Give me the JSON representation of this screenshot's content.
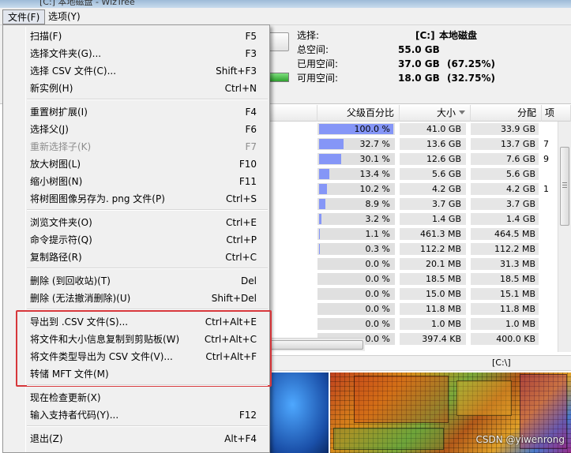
{
  "window": {
    "title": "[C:] 本地磁盘 - WizTree"
  },
  "menubar": {
    "file_label": "文件(F)",
    "options_label": "选项(Y)"
  },
  "drive_info": {
    "select_label": "选择:",
    "drive": "[C:]",
    "drive_name": "本地磁盘",
    "total_label": "总空间:",
    "total_value": "55.0 GB",
    "used_label": "已用空间:",
    "used_value": "37.0 GB",
    "used_pct": "(67.25%)",
    "free_label": "可用空间:",
    "free_value": "18.0 GB",
    "free_pct": "(32.75%)"
  },
  "columns": {
    "parent_pct": "父级百分比",
    "size": "大小",
    "allocated": "分配",
    "items_short": "项"
  },
  "rows": [
    {
      "pct": "100.0 %",
      "fill": 100.0,
      "size": "41.0 GB",
      "alloc": "33.9 GB",
      "x": ""
    },
    {
      "pct": "32.7 %",
      "fill": 32.7,
      "size": "13.6 GB",
      "alloc": "13.7 GB",
      "x": "7"
    },
    {
      "pct": "30.1 %",
      "fill": 30.1,
      "size": "12.6 GB",
      "alloc": "7.6 GB",
      "x": "9"
    },
    {
      "pct": "13.4 %",
      "fill": 13.4,
      "size": "5.6 GB",
      "alloc": "5.6 GB",
      "x": ""
    },
    {
      "pct": "10.2 %",
      "fill": 10.2,
      "size": "4.2 GB",
      "alloc": "4.2 GB",
      "x": "1"
    },
    {
      "pct": "8.9 %",
      "fill": 8.9,
      "size": "3.7 GB",
      "alloc": "3.7 GB",
      "x": ""
    },
    {
      "pct": "3.2 %",
      "fill": 3.2,
      "size": "1.4 GB",
      "alloc": "1.4 GB",
      "x": ""
    },
    {
      "pct": "1.1 %",
      "fill": 1.1,
      "size": "461.3 MB",
      "alloc": "464.5 MB",
      "x": ""
    },
    {
      "pct": "0.3 %",
      "fill": 0.3,
      "size": "112.2 MB",
      "alloc": "112.2 MB",
      "x": ""
    },
    {
      "pct": "0.0 %",
      "fill": 0.0,
      "size": "20.1 MB",
      "alloc": "31.3 MB",
      "x": ""
    },
    {
      "pct": "0.0 %",
      "fill": 0.0,
      "size": "18.5 MB",
      "alloc": "18.5 MB",
      "x": ""
    },
    {
      "pct": "0.0 %",
      "fill": 0.0,
      "size": "15.0 MB",
      "alloc": "15.1 MB",
      "x": ""
    },
    {
      "pct": "0.0 %",
      "fill": 0.0,
      "size": "11.8 MB",
      "alloc": "11.8 MB",
      "x": ""
    },
    {
      "pct": "0.0 %",
      "fill": 0.0,
      "size": "1.0 MB",
      "alloc": "1.0 MB",
      "x": ""
    },
    {
      "pct": "0.0 %",
      "fill": 0.0,
      "size": "397.4 KB",
      "alloc": "400.0 KB",
      "x": ""
    }
  ],
  "statusbar": {
    "path": "[C:\\]"
  },
  "watermark": "CSDN @yiwenrong",
  "file_menu": [
    {
      "label": "扫描(F)",
      "shortcut": "F5",
      "disabled": false
    },
    {
      "label": "选择文件夹(G)...",
      "shortcut": "F3",
      "disabled": false
    },
    {
      "label": "选择 CSV 文件(C)...",
      "shortcut": "Shift+F3",
      "disabled": false
    },
    {
      "label": "新实例(H)",
      "shortcut": "Ctrl+N",
      "disabled": false
    },
    {
      "label": "重置树扩展(I)",
      "shortcut": "F4",
      "disabled": false
    },
    {
      "label": "选择父(J)",
      "shortcut": "F6",
      "disabled": false
    },
    {
      "label": "重新选择子(K)",
      "shortcut": "F7",
      "disabled": true
    },
    {
      "label": "放大树图(L)",
      "shortcut": "F10",
      "disabled": false
    },
    {
      "label": "缩小树图(N)",
      "shortcut": "F11",
      "disabled": false
    },
    {
      "label": "将树图图像另存为. png 文件(P)",
      "shortcut": "Ctrl+S",
      "disabled": false
    },
    {
      "label": "浏览文件夹(O)",
      "shortcut": "Ctrl+E",
      "disabled": false
    },
    {
      "label": "命令提示符(Q)",
      "shortcut": "Ctrl+P",
      "disabled": false
    },
    {
      "label": "复制路径(R)",
      "shortcut": "Ctrl+C",
      "disabled": false
    },
    {
      "label": "删除 (到回收站)(T)",
      "shortcut": "Del",
      "disabled": false
    },
    {
      "label": "删除 (无法撤消删除)(U)",
      "shortcut": "Shift+Del",
      "disabled": false
    },
    {
      "label": "导出到 .CSV 文件(S)...",
      "shortcut": "Ctrl+Alt+E",
      "disabled": false
    },
    {
      "label": "将文件和大小信息复制到剪贴板(W)",
      "shortcut": "Ctrl+Alt+C",
      "disabled": false
    },
    {
      "label": "将文件类型导出为 CSV 文件(V)...",
      "shortcut": "Ctrl+Alt+F",
      "disabled": false
    },
    {
      "label": "转储 MFT 文件(M)",
      "shortcut": "",
      "disabled": false
    },
    {
      "label": "现在检查更新(X)",
      "shortcut": "",
      "disabled": false
    },
    {
      "label": "输入支持者代码(Y)...",
      "shortcut": "F12",
      "disabled": false
    },
    {
      "label": "退出(Z)",
      "shortcut": "Alt+F4",
      "disabled": false
    }
  ]
}
